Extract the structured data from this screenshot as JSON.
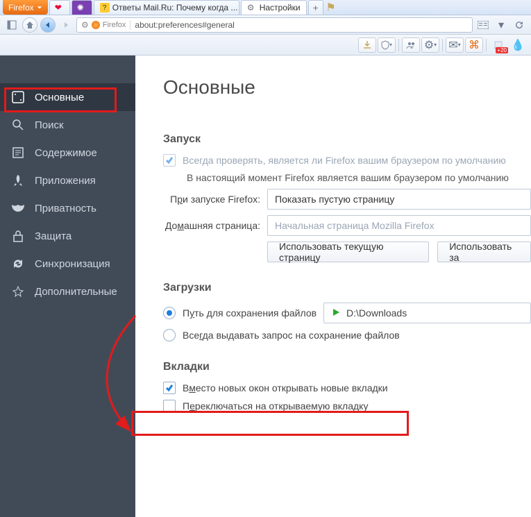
{
  "app_menu_label": "Firefox",
  "tabs": [
    {
      "title": "",
      "icon": "heart"
    },
    {
      "title": "",
      "icon": "violet"
    },
    {
      "title": "Ответы Mail.Ru: Почему когда ...",
      "icon": "mail"
    },
    {
      "title": "Настройки",
      "icon": "gear",
      "active": true
    }
  ],
  "url": {
    "identity": "Firefox",
    "value": "about:preferences#general"
  },
  "toolbar_badge": "+20",
  "sidebar": {
    "items": [
      {
        "label": "Основные",
        "icon": "general",
        "active": true
      },
      {
        "label": "Поиск",
        "icon": "search"
      },
      {
        "label": "Содержимое",
        "icon": "content"
      },
      {
        "label": "Приложения",
        "icon": "apps"
      },
      {
        "label": "Приватность",
        "icon": "privacy"
      },
      {
        "label": "Защита",
        "icon": "security"
      },
      {
        "label": "Синхронизация",
        "icon": "sync"
      },
      {
        "label": "Дополнительные",
        "icon": "advanced"
      }
    ]
  },
  "page": {
    "title": "Основные",
    "startup": {
      "heading": "Запуск",
      "always_check": "Всегда проверять, является ли Firefox вашим браузером по умолчанию",
      "default_status": "В настоящий момент Firefox является вашим браузером по умолчанию",
      "on_start_label": "При запуске Firefox:",
      "on_start_value": "Показать пустую страницу",
      "homepage_label": "Домашняя страница:",
      "homepage_placeholder": "Начальная страница Mozilla Firefox",
      "use_current": "Использовать текущую страницу",
      "use_bookmark": "Использовать за"
    },
    "downloads": {
      "heading": "Загрузки",
      "save_to_label": "Путь для сохранения файлов",
      "save_path": "D:\\Downloads",
      "always_ask": "Всегда выдавать запрос на сохранение файлов"
    },
    "tabs_section": {
      "heading": "Вкладки",
      "open_in_tabs": "Вместо новых окон открывать новые вкладки",
      "switch_to": "Переключаться на открываемую вкладку"
    }
  }
}
